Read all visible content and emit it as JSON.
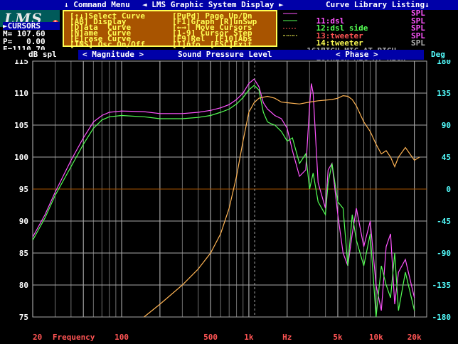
{
  "menubar": {
    "command_menu": "↓ Command Menu",
    "title": "◄ LMS Graphic System Display ►",
    "library": "Curve Library Listing↓"
  },
  "logo": {
    "text": "LMS"
  },
  "cursors": {
    "header": "►CURSORS",
    "m": "M= 107.60",
    "p": "P=   0.00",
    "f": "F=1110.70"
  },
  "commands": [
    "[↑↓]Select Curve",
    "[AB] Display",
    "[D]ata  Curve",
    "[N]ame  Curve",
    "[E]rase Curve",
    "[INS] Osc On/Off",
    "[PuPd] Page Up/Dn",
    "[F1]Graph [R]unSwp",
    "[←→] Move Cursors",
    "[1-9] Cursor Step",
    "[F9]Rel  [F10]Abs",
    "[I]nfo  [ESC]Exit"
  ],
  "curves": [
    {
      "num": "11",
      "name": "dsl",
      "type": "SPL",
      "color": "#ff54ff"
    },
    {
      "num": "12",
      "name": "dsl side",
      "type": "SPL",
      "color": "#54ff54"
    },
    {
      "num": "13",
      "name": "tweeter",
      "type": "SPL",
      "color": "#ff5454"
    },
    {
      "num": "14",
      "name": "tweeter",
      "type": "SPL",
      "color": "#ffff54"
    },
    {
      "num": "15",
      "name": "",
      "type": "SPL",
      "color": "#a8a8a8"
    },
    {
      "num": "16",
      "name": "HIGH MIC AT RIGH",
      "type": "SPL",
      "color": "#a8a8a8"
    }
  ],
  "header": {
    "left_unit": "dB spl",
    "magnitude": "< Magnitude >",
    "spl": "Sound Pressure Level",
    "phase": "< Phase >",
    "right_unit": "Deg"
  },
  "chart_data": {
    "type": "line",
    "xscale": "log",
    "xlim": [
      20,
      25000
    ],
    "ylim": [
      75,
      115
    ],
    "y2lim": [
      -180,
      180
    ],
    "ylabel": "dB spl",
    "y2label": "Deg",
    "xlabel": "Frequency",
    "x_ticks": [
      "20",
      "100",
      "500",
      "1k",
      "Hz",
      "5k",
      "10k",
      "20k"
    ],
    "y_ticks": [
      "115",
      "110",
      "105",
      "100",
      "95",
      "90",
      "85",
      "80",
      "75"
    ],
    "y2_ticks": [
      "180",
      "135",
      "90",
      "45",
      "0",
      "-45",
      "-90",
      "-135",
      "-180"
    ],
    "series": [
      {
        "name": "dsl",
        "color": "#ff54ff",
        "axis": "left",
        "x": [
          20,
          25,
          30,
          40,
          50,
          60,
          70,
          80,
          100,
          150,
          200,
          300,
          400,
          500,
          600,
          700,
          800,
          900,
          1000,
          1100,
          1200,
          1300,
          1400,
          1500,
          1600,
          1800,
          2000,
          2200,
          2500,
          2800,
          3000,
          3100,
          3200,
          3500,
          4000,
          4200,
          4500,
          5000,
          5500,
          6000,
          6500,
          7000,
          8000,
          9000,
          10000,
          11000,
          12000,
          13000,
          14000,
          15000,
          17000,
          20000
        ],
        "y": [
          87.5,
          91,
          94.5,
          99.5,
          103,
          105.5,
          106.5,
          107,
          107.2,
          107.1,
          106.8,
          106.8,
          107,
          107.3,
          107.7,
          108.2,
          109,
          110,
          111.5,
          112.2,
          111,
          108.5,
          107.5,
          107,
          106.5,
          106,
          104.5,
          101,
          97,
          98,
          108,
          111.5,
          110,
          96,
          92,
          98,
          99,
          91,
          85,
          83,
          88,
          92,
          86,
          90,
          80,
          76,
          86,
          88,
          77,
          82,
          84,
          78
        ]
      },
      {
        "name": "dsl side",
        "color": "#54ff54",
        "axis": "left",
        "x": [
          20,
          25,
          30,
          40,
          50,
          60,
          70,
          80,
          100,
          150,
          200,
          300,
          400,
          500,
          600,
          700,
          800,
          900,
          1000,
          1100,
          1200,
          1300,
          1400,
          1500,
          1600,
          1800,
          2000,
          2200,
          2500,
          2800,
          3000,
          3200,
          3500,
          4000,
          4200,
          4500,
          5000,
          5500,
          6000,
          6500,
          7000,
          8000,
          9000,
          10000,
          11000,
          12000,
          13000,
          14000,
          15000,
          17000,
          20000
        ],
        "y": [
          87,
          90.5,
          94,
          98.5,
          102,
          104.5,
          105.8,
          106.3,
          106.5,
          106.3,
          106,
          106,
          106.2,
          106.5,
          107,
          107.5,
          108.3,
          109.3,
          110.5,
          111.2,
          110.5,
          107,
          105.5,
          105.2,
          105,
          104,
          102.5,
          103,
          99,
          100.5,
          95,
          97.5,
          93,
          91,
          96,
          99,
          93,
          92,
          83,
          91,
          87,
          83,
          88,
          75,
          83,
          80,
          78,
          85,
          76,
          82,
          76
        ]
      },
      {
        "name": "tweeter",
        "color": "#ffb454",
        "axis": "left",
        "x": [
          150,
          200,
          300,
          400,
          500,
          600,
          700,
          800,
          900,
          1000,
          1100,
          1200,
          1400,
          1600,
          1800,
          2000,
          2500,
          3000,
          3500,
          4000,
          4500,
          5000,
          5500,
          6000,
          6500,
          7000,
          8000,
          9000,
          10000,
          11000,
          12000,
          13000,
          14000,
          15000,
          17000,
          20000,
          22000
        ],
        "y": [
          75,
          77,
          80,
          82.5,
          85,
          88,
          92,
          97,
          102.5,
          107,
          108.5,
          109.2,
          109.5,
          109.2,
          108.6,
          108.5,
          108.3,
          108.6,
          108.8,
          108.9,
          109,
          109.2,
          109.6,
          109.5,
          109,
          108,
          105.5,
          104,
          102,
          100.5,
          101,
          100,
          98.5,
          100,
          101.5,
          99.5,
          100
        ]
      }
    ]
  }
}
